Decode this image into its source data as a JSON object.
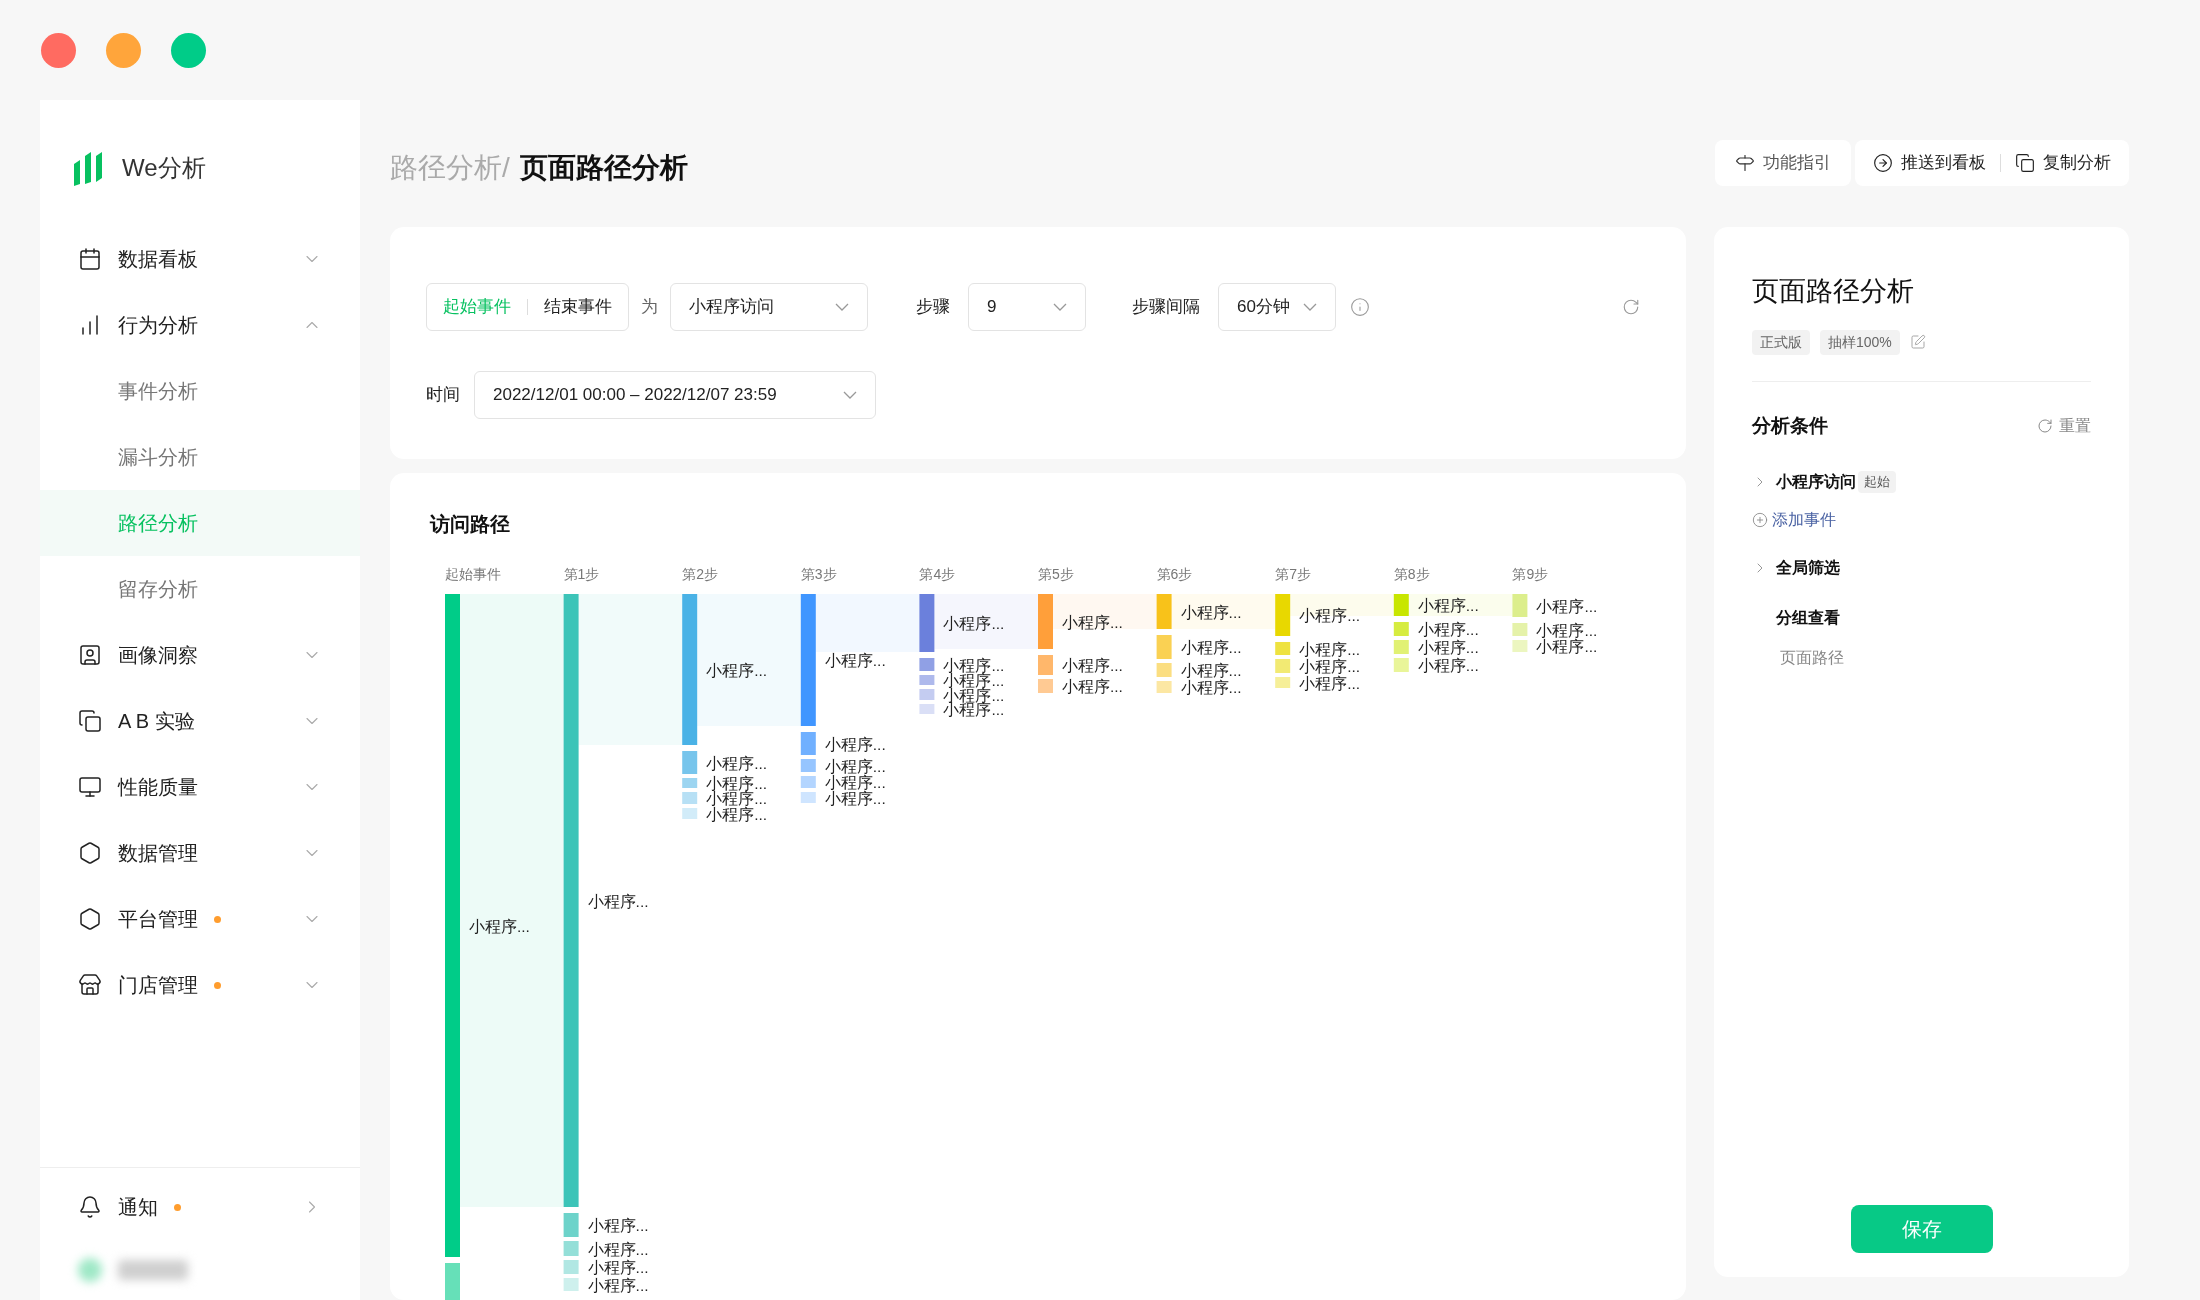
{
  "window": {
    "controls": [
      {
        "color": "#ff6b61"
      },
      {
        "color": "#ffa53b"
      },
      {
        "color": "#00cc88"
      }
    ]
  },
  "sidebar": {
    "logo_text": "We分析",
    "items": [
      {
        "label": "数据看板",
        "expanded": false,
        "dot": false
      },
      {
        "label": "行为分析",
        "expanded": true,
        "dot": false,
        "children": [
          {
            "label": "事件分析",
            "selected": false
          },
          {
            "label": "漏斗分析",
            "selected": false
          },
          {
            "label": "路径分析",
            "selected": true
          },
          {
            "label": "留存分析",
            "selected": false
          }
        ]
      },
      {
        "label": "画像洞察",
        "expanded": false,
        "dot": false
      },
      {
        "label": "A B 实验",
        "expanded": false,
        "dot": false
      },
      {
        "label": "性能质量",
        "expanded": false,
        "dot": false
      },
      {
        "label": "数据管理",
        "expanded": false,
        "dot": false
      },
      {
        "label": "平台管理",
        "expanded": false,
        "dot": true
      },
      {
        "label": "门店管理",
        "expanded": false,
        "dot": true
      }
    ],
    "footer": [
      {
        "label": "通知",
        "dot": true
      }
    ]
  },
  "breadcrumb": {
    "parent": "路径分析/",
    "current": "页面路径分析"
  },
  "toolbar": [
    "功能指引",
    "推送到看板",
    "复制分析"
  ],
  "filters": {
    "event_toggle": [
      {
        "label": "起始事件",
        "selected": true
      },
      {
        "label": "结束事件",
        "selected": false
      }
    ],
    "connector": "为",
    "event_select": "小程序访问",
    "steps_label": "步骤",
    "steps_value": "9",
    "interval_label": "步骤间隔",
    "interval_value": "60分钟",
    "time_label": "时间",
    "time_value": "2022/12/01 00:00 – 2022/12/07 23:59"
  },
  "path_card": {
    "title": "访问路径",
    "columns": [
      {
        "header": "起始事件",
        "color": "#00cc88",
        "nodes": [
          {
            "label": "小程序...",
            "kind": "main"
          },
          {
            "kind": "sub"
          }
        ]
      },
      {
        "header": "第1步",
        "color": "#3cc4b8",
        "nodes": [
          {
            "label": "小程序..."
          },
          {
            "label": "小程序..."
          },
          {
            "label": "小程序..."
          },
          {
            "label": "小程序..."
          },
          {
            "label": "小程序..."
          }
        ]
      },
      {
        "header": "第2步",
        "color": "#4ab2e6",
        "nodes": [
          {
            "label": "小程序..."
          },
          {
            "label": "小程序..."
          },
          {
            "label": "小程序..."
          },
          {
            "label": "小程序..."
          },
          {
            "label": "小程序..."
          }
        ]
      },
      {
        "header": "第3步",
        "color": "#4096ff",
        "nodes": [
          {
            "label": "小程序..."
          },
          {
            "label": "小程序..."
          },
          {
            "label": "小程序..."
          },
          {
            "label": "小程序..."
          },
          {
            "label": "小程序..."
          }
        ]
      },
      {
        "header": "第4步",
        "color": "#6b80dc",
        "nodes": [
          {
            "label": "小程序..."
          },
          {
            "label": "小程序..."
          },
          {
            "label": "小程序..."
          },
          {
            "label": "小程序..."
          },
          {
            "label": "小程序..."
          }
        ]
      },
      {
        "header": "第5步",
        "color": "#ff9f3a",
        "nodes": [
          {
            "label": "小程序..."
          },
          {
            "label": "小程序..."
          },
          {
            "label": "小程序..."
          }
        ]
      },
      {
        "header": "第6步",
        "color": "#f8c21a",
        "nodes": [
          {
            "label": "小程序..."
          },
          {
            "label": "小程序..."
          },
          {
            "label": "小程序..."
          },
          {
            "label": "小程序..."
          }
        ]
      },
      {
        "header": "第7步",
        "color": "#e8d800",
        "nodes": [
          {
            "label": "小程序..."
          },
          {
            "label": "小程序..."
          },
          {
            "label": "小程序..."
          },
          {
            "label": "小程序..."
          }
        ]
      },
      {
        "header": "第8步",
        "color": "#c8e600",
        "nodes": [
          {
            "label": "小程序..."
          },
          {
            "label": "小程序..."
          },
          {
            "label": "小程序..."
          },
          {
            "label": "小程序..."
          }
        ]
      },
      {
        "header": "第9步",
        "color": "#dcee8c",
        "nodes": [
          {
            "label": "小程序..."
          },
          {
            "label": "小程序..."
          },
          {
            "label": "小程序..."
          }
        ]
      }
    ]
  },
  "panel": {
    "title": "页面路径分析",
    "tags": [
      "正式版",
      "抽样100%"
    ],
    "conditions_title": "分析条件",
    "reset": "重置",
    "event": {
      "label": "小程序访问",
      "tag": "起始"
    },
    "add_event": "添加事件",
    "global_filter": "全局筛选",
    "group_title": "分组查看",
    "group_value": "页面路径",
    "save": "保存"
  }
}
